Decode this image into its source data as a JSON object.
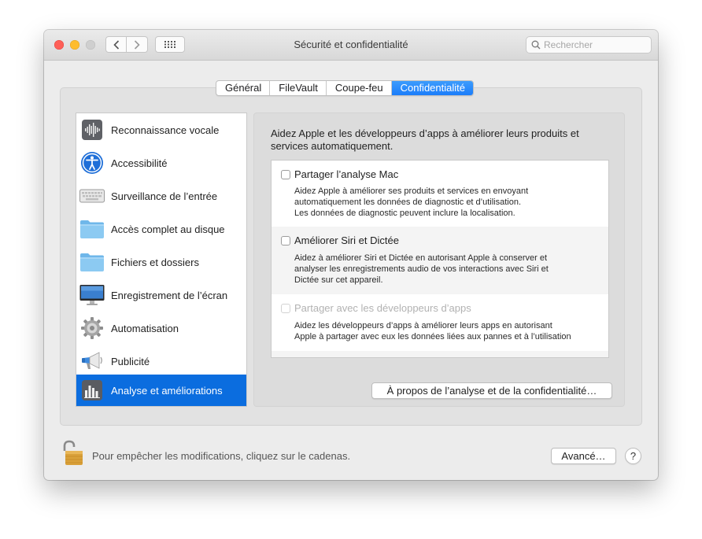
{
  "window": {
    "title": "Sécurité et confidentialité"
  },
  "titlebar": {
    "back_icon": "chevron-left-icon",
    "forward_icon": "chevron-right-icon",
    "grid_icon": "grid-icon",
    "search": {
      "placeholder": "Rechercher",
      "value": "",
      "icon": "search-icon"
    }
  },
  "tabs": [
    {
      "label": "Général",
      "active": false
    },
    {
      "label": "FileVault",
      "active": false
    },
    {
      "label": "Coupe-feu",
      "active": false
    },
    {
      "label": "Confidentialité",
      "active": true
    }
  ],
  "sidebar": {
    "items": [
      {
        "label": "Reconnaissance vocale",
        "icon": "waveform-icon",
        "selected": false
      },
      {
        "label": "Accessibilité",
        "icon": "accessibility-icon",
        "selected": false
      },
      {
        "label": "Surveillance de l’entrée",
        "icon": "keyboard-icon",
        "selected": false
      },
      {
        "label": "Accès complet au disque",
        "icon": "folder-icon",
        "selected": false
      },
      {
        "label": "Fichiers et dossiers",
        "icon": "folder-icon",
        "selected": false
      },
      {
        "label": "Enregistrement de l’écran",
        "icon": "display-icon",
        "selected": false
      },
      {
        "label": "Automatisation",
        "icon": "gear-icon",
        "selected": false
      },
      {
        "label": "Publicité",
        "icon": "megaphone-icon",
        "selected": false
      },
      {
        "label": "Analyse et améliorations",
        "icon": "bar-chart-icon",
        "selected": true
      }
    ]
  },
  "content": {
    "intro": "Aidez Apple et les développeurs d’apps à améliorer leurs produits et services automatiquement.",
    "options": [
      {
        "title": "Partager l’analyse Mac",
        "checked": false,
        "enabled": true,
        "lines": [
          "Aidez Apple à améliorer ses produits et services en envoyant",
          "automatiquement les données de diagnostic et d’utilisation.",
          "Les données de diagnostic peuvent inclure la localisation."
        ]
      },
      {
        "title": "Améliorer Siri et Dictée",
        "checked": false,
        "enabled": true,
        "lines": [
          "Aidez à améliorer Siri et Dictée en autorisant Apple à conserver et",
          "analyser les enregistrements audio de vos interactions avec Siri et",
          "Dictée sur cet appareil."
        ]
      },
      {
        "title": "Partager avec les développeurs d’apps",
        "checked": false,
        "enabled": false,
        "lines": [
          "Aidez les développeurs d’apps à améliorer leurs apps en autorisant",
          "Apple à partager avec eux les données liées aux pannes et à l’utilisation"
        ]
      }
    ],
    "about_button": "À propos de l’analyse et de la confidentialité…"
  },
  "footer": {
    "lock_icon": "padlock-icon",
    "lock_message": "Pour empêcher les modifications, cliquez sur le cadenas.",
    "advanced_button": "Avancé…",
    "help_button": "?"
  },
  "colors": {
    "accent": "#0b6ddf",
    "tab_active": "#1b7dfa"
  }
}
